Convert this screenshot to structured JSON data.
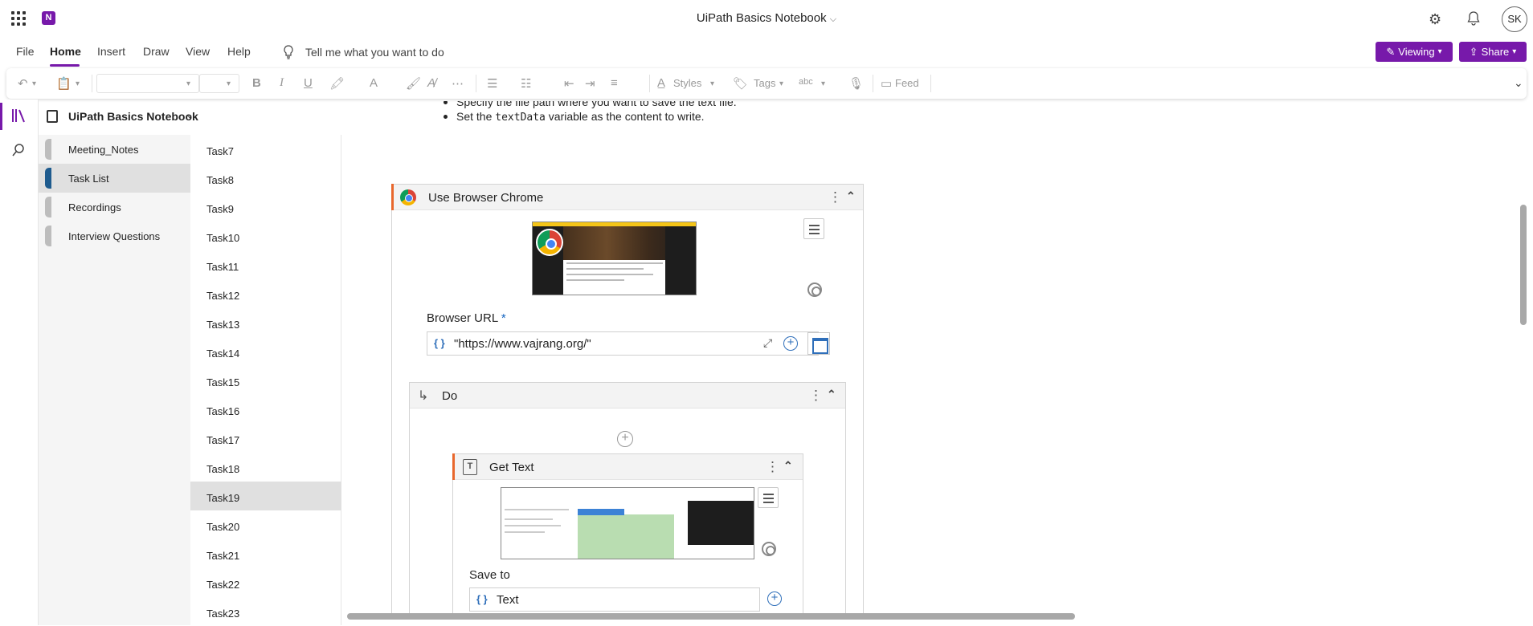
{
  "app": {
    "title": "UiPath Basics Notebook",
    "title_chevron": "⌵",
    "logo_letter": "N",
    "avatar_initials": "SK",
    "gear_icon": "⚙",
    "bell_icon": "🔔"
  },
  "menu": {
    "items": [
      "File",
      "Home",
      "Insert",
      "Draw",
      "View",
      "Help"
    ],
    "active": "Home",
    "tell_me": "Tell me what you want to do",
    "viewing_label": "Viewing",
    "share_label": "Share"
  },
  "ribbon": {
    "styles_label": "Styles",
    "tags_label": "Tags",
    "feed_label": "Feed",
    "bold": "B",
    "italic": "I",
    "underline": "U",
    "font_color": "A",
    "spell": "abc"
  },
  "notebook": {
    "name": "UiPath Basics Notebook",
    "sections": [
      "Meeting_Notes",
      "Task List",
      "Recordings",
      "Interview Questions"
    ],
    "active_section": "Task List",
    "pages": [
      "Task7",
      "Task8",
      "Task9",
      "Task10",
      "Task11",
      "Task12",
      "Task13",
      "Task14",
      "Task15",
      "Task16",
      "Task17",
      "Task18",
      "Task19",
      "Task20",
      "Task21",
      "Task22",
      "Task23"
    ],
    "active_page": "Task19"
  },
  "content": {
    "bullet1": "Specify the file path where you want to save the text file.",
    "bullet2_pre": "Set the ",
    "bullet2_code": "textData",
    "bullet2_post": " variable as the content to write.",
    "browser_card": {
      "title": "Use Browser Chrome",
      "url_label": "Browser URL",
      "required_mark": "*",
      "braces": "{ }",
      "url_value": "\"https://www.vajrang.org/\""
    },
    "do_card": {
      "title": "Do"
    },
    "gettext_card": {
      "title": "Get Text",
      "save_to_label": "Save to",
      "braces": "{ }",
      "save_to_value": "Text"
    }
  },
  "colors": {
    "accent_purple": "#7719aa",
    "activity_accent": "#e8672c",
    "section_active": "#1e5b8e",
    "link_blue": "#2f6fba"
  }
}
